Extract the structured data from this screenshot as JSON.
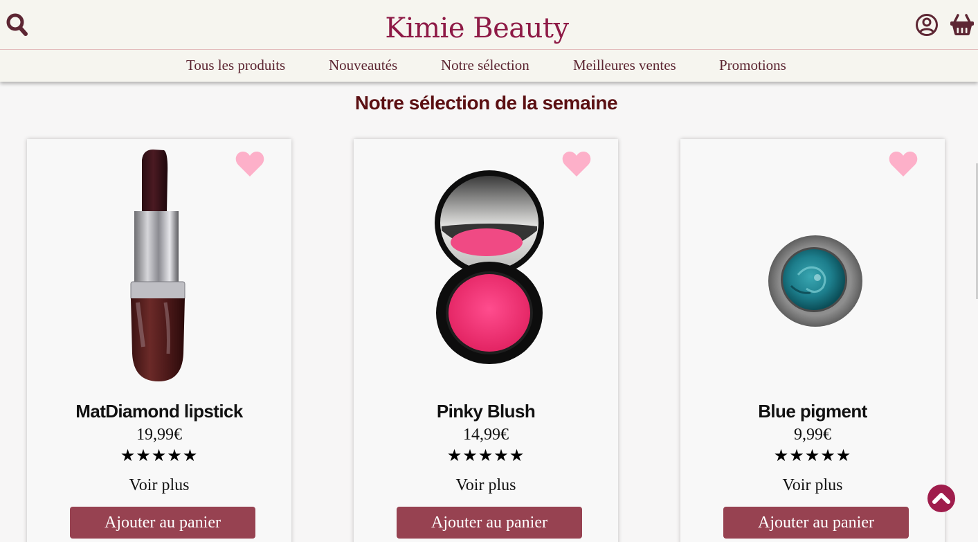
{
  "header": {
    "brand": "Kimie Beauty",
    "icons": {
      "search": "search-icon",
      "account": "user-circle-icon",
      "cart": "basket-icon"
    }
  },
  "nav": {
    "items": [
      {
        "label": "Tous les produits"
      },
      {
        "label": "Nouveautés"
      },
      {
        "label": "Notre sélection"
      },
      {
        "label": "Meilleures ventes"
      },
      {
        "label": "Promotions"
      }
    ]
  },
  "section": {
    "title": "Notre sélection de la semaine"
  },
  "products": [
    {
      "name": "MatDiamond lipstick",
      "price": "19,99€",
      "rating": 5,
      "stars": "★★★★★",
      "more_label": "Voir plus",
      "cta_label": "Ajouter au panier",
      "image": "lipstick-image"
    },
    {
      "name": "Pinky Blush",
      "price": "14,99€",
      "rating": 5,
      "stars": "★★★★★",
      "more_label": "Voir plus",
      "cta_label": "Ajouter au panier",
      "image": "blush-compact-image"
    },
    {
      "name": "Blue pigment",
      "price": "9,99€",
      "rating": 5,
      "stars": "★★★★★",
      "more_label": "Voir plus",
      "cta_label": "Ajouter au panier",
      "image": "pigment-jar-image"
    }
  ],
  "colors": {
    "brand": "#8e1a46",
    "nav_text": "#5b2430",
    "title": "#5b0f12",
    "button": "#974251",
    "favorite_heart": "#fdb0c9",
    "scroll_top": "#9f1d4c"
  }
}
